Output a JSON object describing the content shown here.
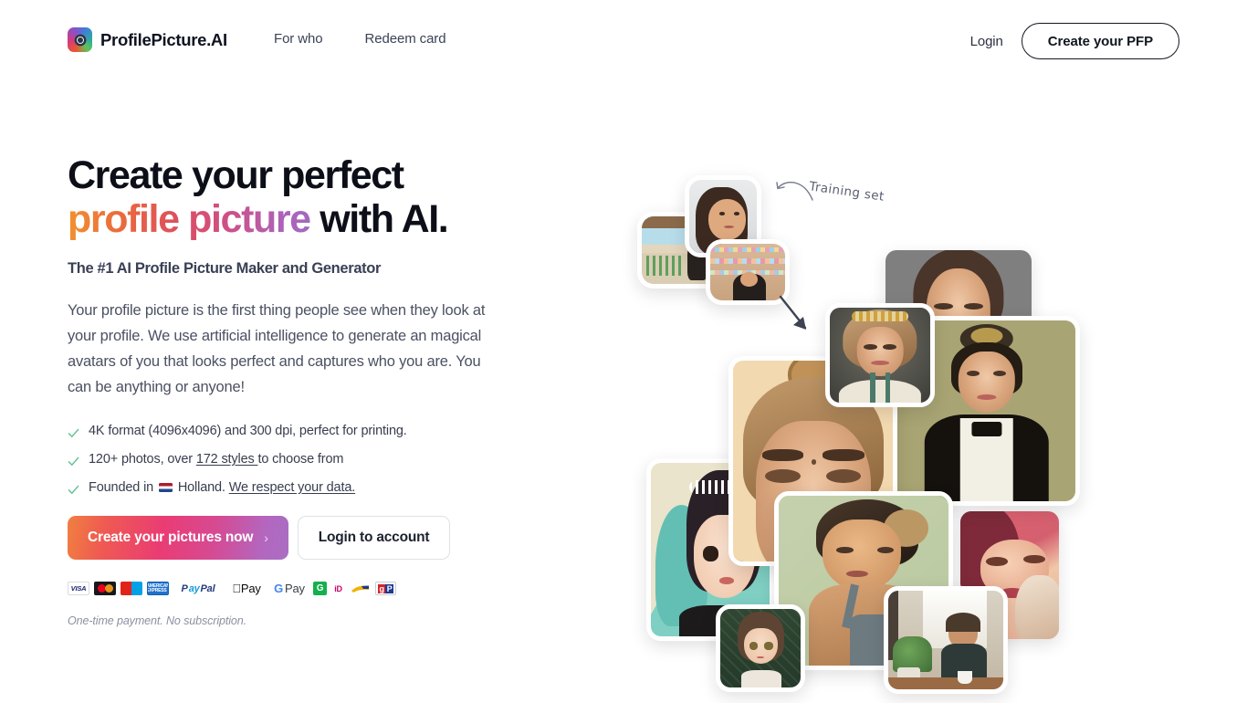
{
  "brand": {
    "name": "ProfilePicture.AI",
    "logo_icon": "profilepicture-camera-logo-icon"
  },
  "nav": {
    "links": [
      {
        "label": "For who"
      },
      {
        "label": "Redeem card"
      }
    ],
    "login_label": "Login",
    "cta_label": "Create your PFP"
  },
  "hero": {
    "headline_line1": "Create your perfect",
    "headline_gradient": "profile picture",
    "headline_line2_tail": " with AI.",
    "subhead": "The #1 AI Profile Picture Maker and Generator",
    "body": "Your profile picture is the first thing people see when they look at your profile. We use artificial intelligence to generate an magical avatars of you that looks perfect and captures who you are. You can be anything or anyone!",
    "features": [
      {
        "text_before": "4K format (4096x4096) and 300 dpi, perfect for printing.",
        "link": "",
        "text_after": "",
        "flag": false
      },
      {
        "text_before": "120+ photos, over ",
        "link": "172 styles ",
        "text_after": "to choose from",
        "flag": false
      },
      {
        "text_before": "Founded in ",
        "link": "We respect your data.",
        "text_after": " Holland. ",
        "flag": true
      }
    ],
    "cta_primary": "Create your pictures now",
    "cta_primary_chevron": "›",
    "cta_secondary": "Login to account",
    "fineprint": "One-time payment. No subscription.",
    "payments": [
      {
        "name": "visa",
        "label": "VISA"
      },
      {
        "name": "mastercard",
        "label": ""
      },
      {
        "name": "maestro",
        "label": "maestro"
      },
      {
        "name": "amex",
        "label": "AMEX"
      },
      {
        "name": "paypal",
        "label": "PayPal"
      },
      {
        "name": "apple-pay",
        "label": "Pay"
      },
      {
        "name": "google-pay",
        "label": "Pay"
      },
      {
        "name": "giropay",
        "label": "G"
      },
      {
        "name": "ideal",
        "label": "iD"
      },
      {
        "name": "sofort",
        "label": ""
      },
      {
        "name": "gp",
        "label": "gP"
      }
    ]
  },
  "collage": {
    "training_label": "Training set",
    "training_photos": [
      {
        "alt": "woman-on-beach-photo"
      },
      {
        "alt": "woman-looking-away-photo"
      },
      {
        "alt": "woman-in-store-photo"
      }
    ],
    "generated_photos": [
      {
        "alt": "avatar-grey-background"
      },
      {
        "alt": "avatar-floral-crown"
      },
      {
        "alt": "avatar-tuxedo-olive"
      },
      {
        "alt": "avatar-closeup-beige"
      },
      {
        "alt": "avatar-anime-mint"
      },
      {
        "alt": "avatar-green-background"
      },
      {
        "alt": "avatar-pink-closeup"
      },
      {
        "alt": "avatar-anime-small"
      },
      {
        "alt": "photo-woman-cafe"
      }
    ]
  }
}
